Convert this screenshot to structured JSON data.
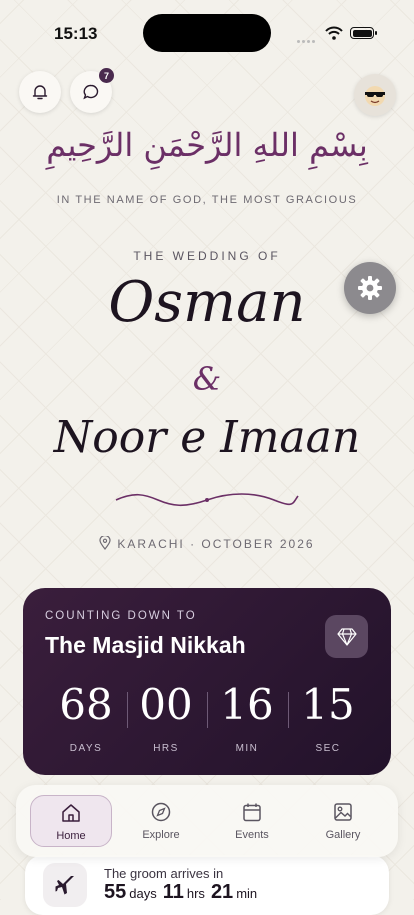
{
  "status_bar": {
    "time": "15:13"
  },
  "header": {
    "notification_badge": "7"
  },
  "invitation": {
    "bismillah": "بِسْمِ اللهِ الرَّحْمَنِ الرَّحِيمِ",
    "translation": "IN THE NAME OF GOD, THE MOST GRACIOUS",
    "subtitle": "THE WEDDING OF",
    "groom": "Osman",
    "ampersand": "&",
    "bride": "Noor e Imaan",
    "location": "KARACHI · OCTOBER 2026"
  },
  "countdown": {
    "label": "COUNTING DOWN TO",
    "event": "The Masjid Nikkah",
    "units": [
      {
        "value": "68",
        "label": "DAYS"
      },
      {
        "value": "00",
        "label": "HRS"
      },
      {
        "value": "16",
        "label": "MIN"
      },
      {
        "value": "15",
        "label": "SEC"
      }
    ]
  },
  "nav": {
    "items": [
      {
        "label": "Home",
        "icon": "home-icon",
        "active": true
      },
      {
        "label": "Explore",
        "icon": "compass-icon"
      },
      {
        "label": "Events",
        "icon": "calendar-icon"
      },
      {
        "label": "Gallery",
        "icon": "image-icon"
      }
    ]
  },
  "arrival": {
    "label": "The groom arrives in",
    "days": "55",
    "days_unit": "days",
    "hrs": "11",
    "hrs_unit": "hrs",
    "min": "21",
    "min_unit": "min"
  },
  "colors": {
    "accent": "#6b2f66",
    "card": "#2e1834",
    "background": "#f3f1eb"
  }
}
